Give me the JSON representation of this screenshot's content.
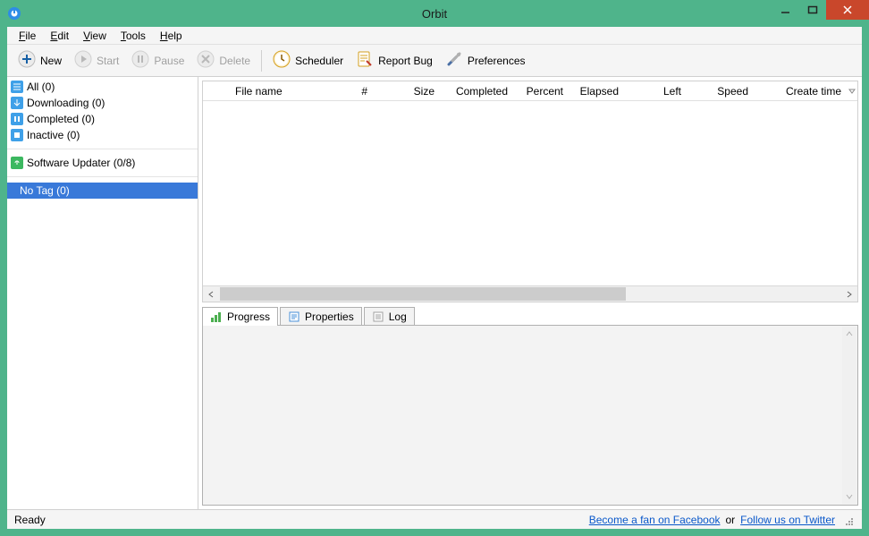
{
  "window": {
    "title": "Orbit"
  },
  "menus": {
    "file": "File",
    "edit": "Edit",
    "view": "View",
    "tools": "Tools",
    "help": "Help"
  },
  "toolbar": {
    "new": "New",
    "start": "Start",
    "pause": "Pause",
    "delete": "Delete",
    "scheduler": "Scheduler",
    "report_bug": "Report Bug",
    "preferences": "Preferences"
  },
  "sidebar": {
    "all": "All (0)",
    "downloading": "Downloading (0)",
    "completed": "Completed (0)",
    "inactive": "Inactive (0)",
    "software_updater": "Software Updater (0/8)",
    "no_tag": "No Tag (0)"
  },
  "columns": {
    "filename": "File name",
    "hash": "#",
    "size": "Size",
    "completed": "Completed",
    "percent": "Percent",
    "elapsed": "Elapsed",
    "left": "Left",
    "speed": "Speed",
    "create_time": "Create time"
  },
  "tabs": {
    "progress": "Progress",
    "properties": "Properties",
    "log": "Log"
  },
  "status": {
    "ready": "Ready",
    "fb": "Become a fan on Facebook",
    "or": "or",
    "tw": "Follow us on Twitter"
  }
}
